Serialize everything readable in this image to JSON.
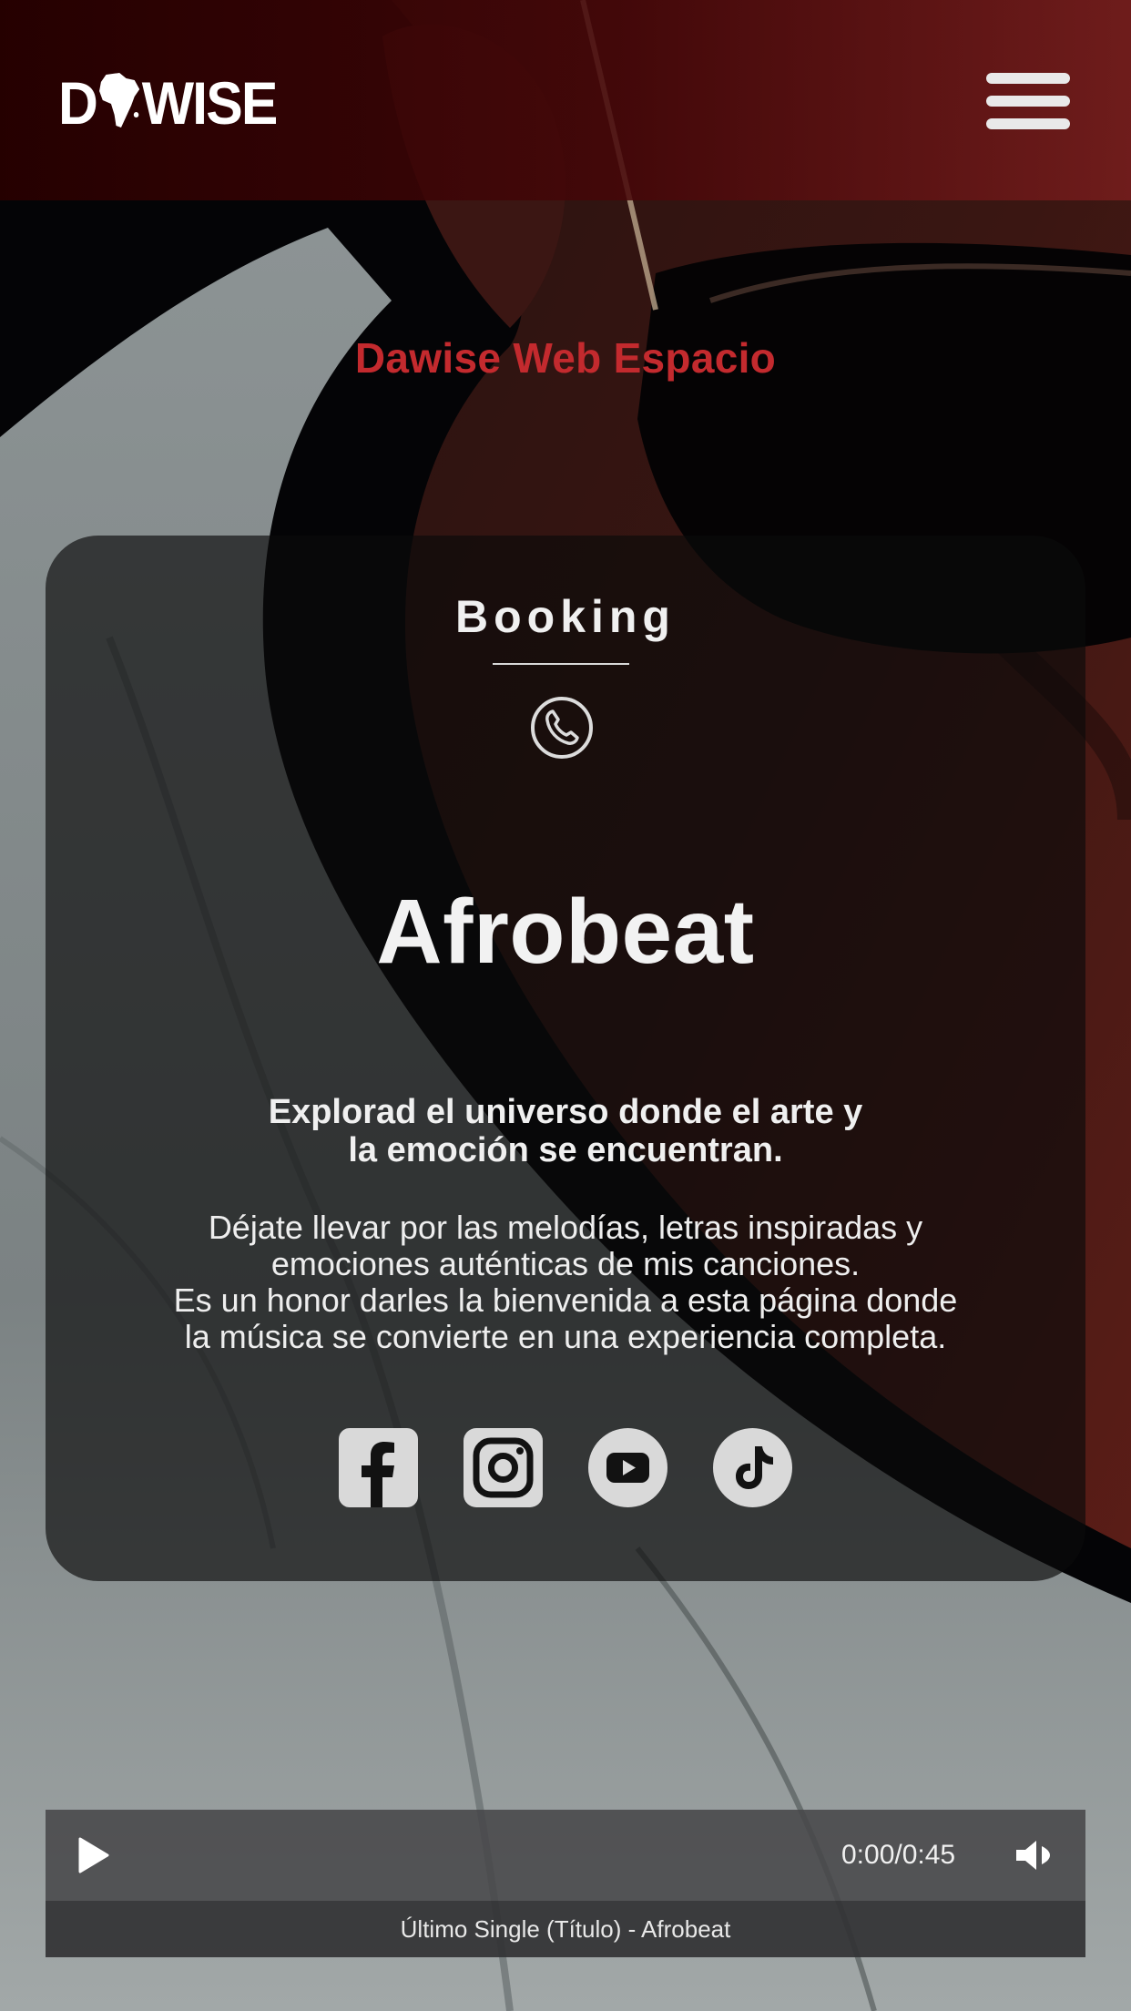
{
  "header": {
    "logo_text_start": "D",
    "logo_text_end": "WISE",
    "menu_icon": "hamburger-menu-icon"
  },
  "site_title": "Dawise Web Espacio",
  "card": {
    "booking_label": "Booking",
    "phone_icon": "phone-icon",
    "genre": "Afrobeat",
    "tagline_line1": "Explorad el universo donde el arte y",
    "tagline_line2": "la emoción se encuentran.",
    "intro_lines": [
      "Déjate llevar por las melodías, letras inspiradas y",
      "emociones auténticas de mis canciones.",
      "Es un honor darles la bienvenida a esta página donde",
      "la música se convierte en una experiencia completa."
    ],
    "socials": [
      "facebook-icon",
      "instagram-icon",
      "youtube-icon",
      "tiktok-icon"
    ]
  },
  "player": {
    "time": "0:00/0:45",
    "caption": "Último Single (Título) - Afrobeat",
    "progress": 0
  },
  "colors": {
    "accent": "#c32a2e",
    "header_dark": "#280000",
    "icon": "#d9d9d9"
  }
}
